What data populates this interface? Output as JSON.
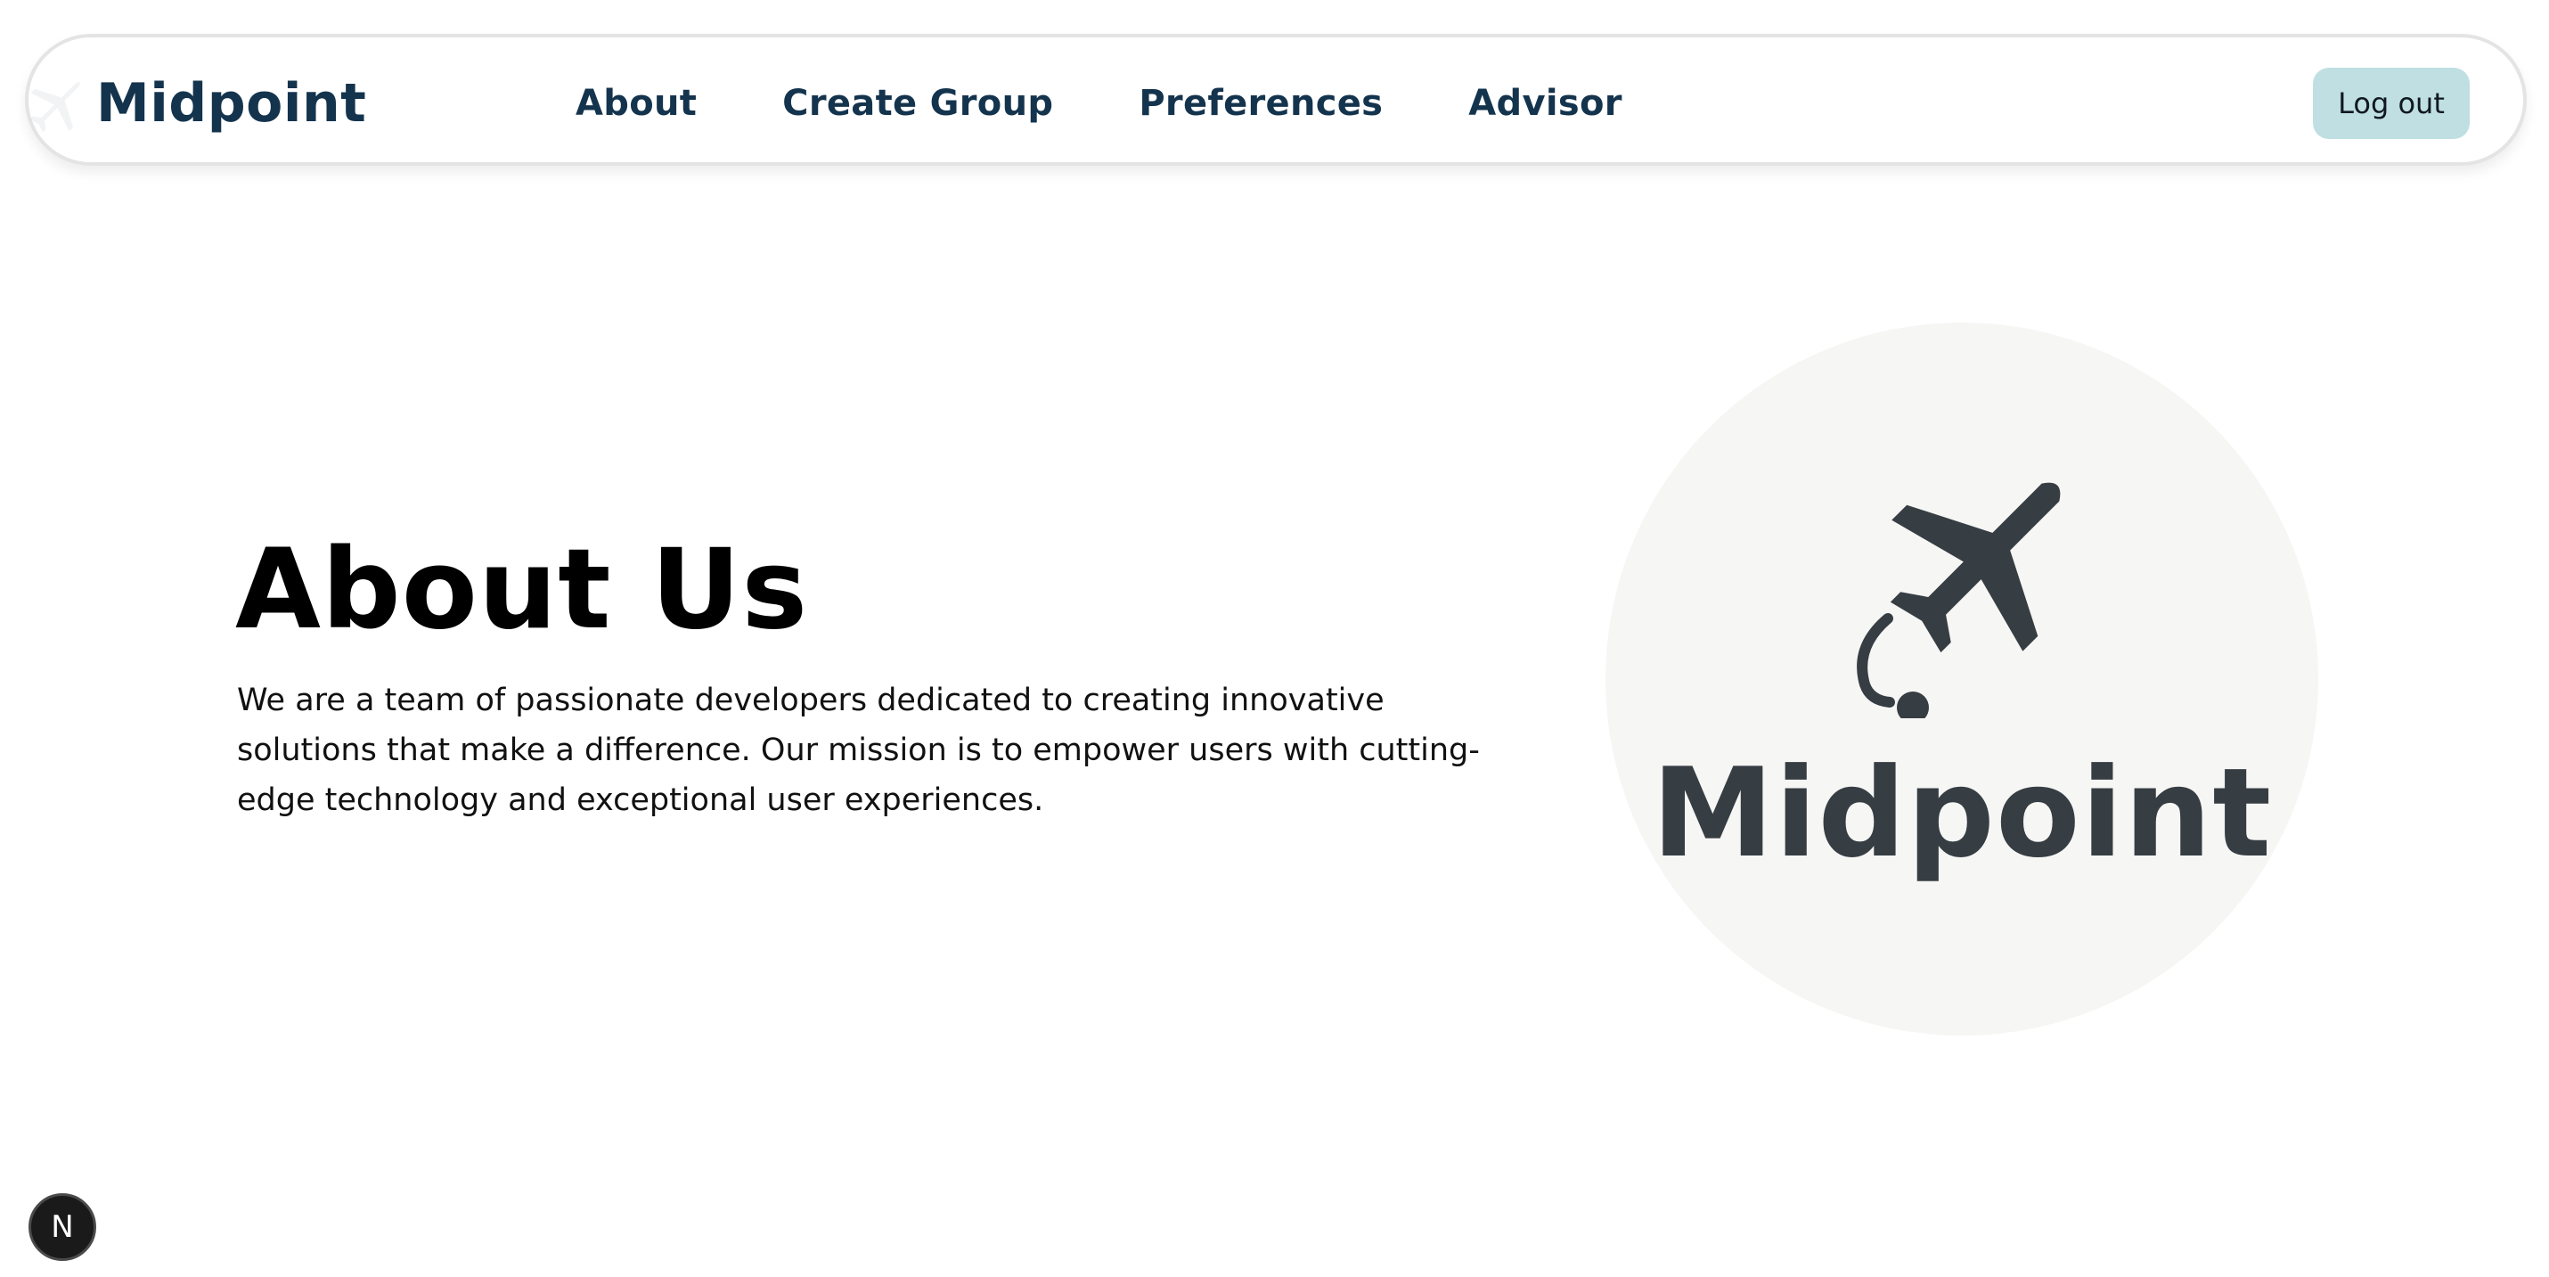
{
  "nav": {
    "brand": "Midpoint",
    "links": [
      "About",
      "Create Group",
      "Preferences",
      "Advisor"
    ],
    "logout_label": "Log out"
  },
  "hero": {
    "title": "About Us",
    "text": "We are a team of passionate developers dedicated to creating innovative solutions that make a difference. Our mission is to empower users with cutting-edge technology and exceptional user experiences."
  },
  "logo": {
    "text": "Midpoint",
    "icon": "airplane-icon"
  },
  "dev_badge": {
    "label": "N"
  },
  "colors": {
    "brand_navy": "#14344e",
    "logout_bg": "#bfdfe2",
    "logo_circle": "#f6f6f4",
    "logo_mark": "#363d43"
  }
}
